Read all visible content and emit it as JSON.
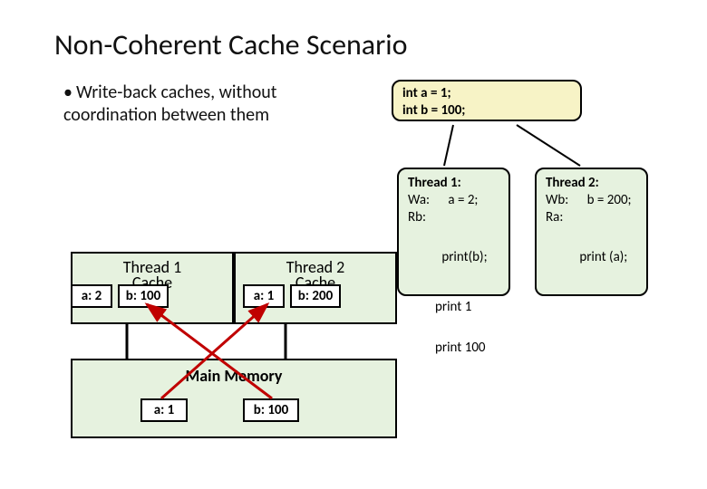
{
  "title": "Non-Coherent Cache Scenario",
  "bullet": "Write-back caches, without coordination between them",
  "init": {
    "line1": "int a = 1;",
    "line2": "int b = 100;"
  },
  "thread1": {
    "title": "Thread 1:",
    "l1a": "Wa:",
    "l1b": "a = 2;",
    "l2a": "Rb:",
    "l3a": "print(b);"
  },
  "thread2": {
    "title": "Thread 2:",
    "l1a": "Wb:",
    "l1b": "b = 200;",
    "l2a": "Ra:",
    "l3a": "print (a);"
  },
  "cache1": {
    "label_top": "Thread 1",
    "label_bot": "Cache",
    "a": "a: 2",
    "b": "b: 100"
  },
  "cache2": {
    "label_top": "Thread 2",
    "label_bot": "Cache",
    "a": "a: 1",
    "b": "b: 200"
  },
  "mem": {
    "label": "Main Memory",
    "a": "a: 1",
    "b": "b: 100"
  },
  "out1": "print 1",
  "out100": "print 100"
}
